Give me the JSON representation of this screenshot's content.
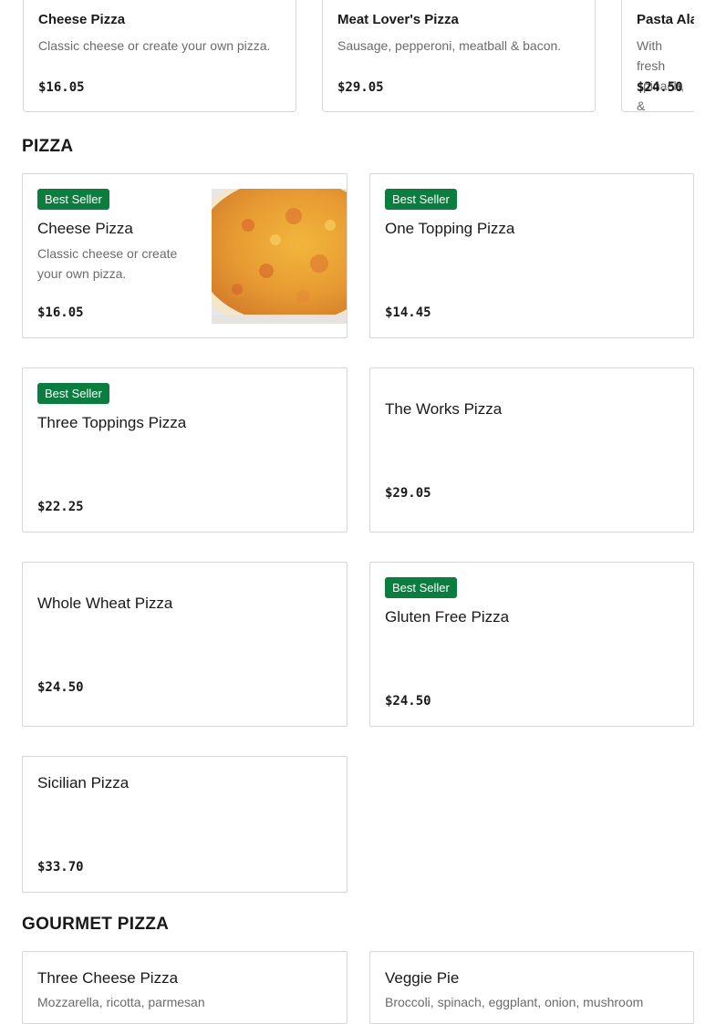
{
  "featured": [
    {
      "name": "Cheese Pizza",
      "desc": "Classic cheese or create your own pizza.",
      "price": "$16.05"
    },
    {
      "name": "Meat Lover's Pizza",
      "desc": "Sausage, pepperoni, meatball & bacon.",
      "price": "$29.05"
    },
    {
      "name": "Pasta Ala",
      "desc": "With fresh spinach, &",
      "price": "$24.50"
    }
  ],
  "sections": {
    "pizza": {
      "title": "PIZZA",
      "items": [
        {
          "badge": "Best Seller",
          "name": "Cheese Pizza",
          "desc": "Classic cheese or create your own pizza.",
          "price": "$16.05"
        },
        {
          "badge": "Best Seller",
          "name": "One Topping Pizza",
          "price": "$14.45"
        },
        {
          "badge": "Best Seller",
          "name": "Three Toppings Pizza",
          "price": "$22.25"
        },
        {
          "name": "The Works Pizza",
          "price": "$29.05"
        },
        {
          "name": "Whole Wheat Pizza",
          "price": "$24.50"
        },
        {
          "badge": "Best Seller",
          "name": "Gluten Free Pizza",
          "price": "$24.50"
        },
        {
          "name": "Sicilian Pizza",
          "price": "$33.70"
        }
      ]
    },
    "gourmet": {
      "title": "GOURMET PIZZA",
      "items": [
        {
          "name": "Three Cheese Pizza",
          "desc": "Mozzarella, ricotta, parmesan"
        },
        {
          "name": "Veggie Pie",
          "desc": "Broccoli, spinach, eggplant, onion, mushroom"
        }
      ]
    }
  },
  "colors": {
    "badge": "#0b7d3e",
    "text": "#191919",
    "muted": "#6b6b6b",
    "border": "#d6d6d6"
  }
}
